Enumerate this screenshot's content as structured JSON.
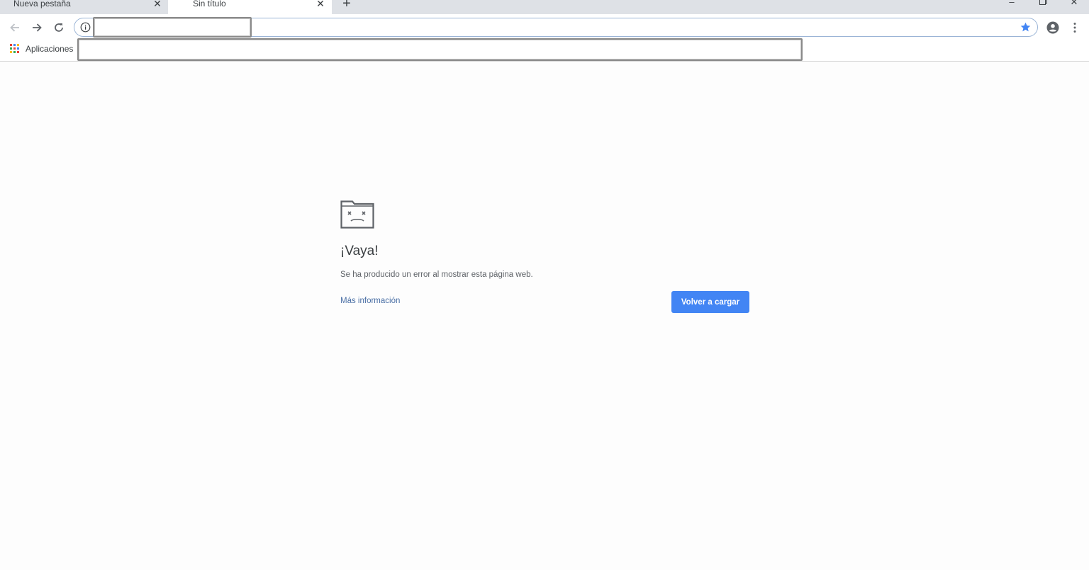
{
  "tabs": [
    {
      "title": "Nueva pestaña",
      "active": false
    },
    {
      "title": "Sin título",
      "active": true
    }
  ],
  "toolbar": {
    "back_icon": "arrow-left-icon",
    "forward_icon": "arrow-right-icon",
    "reload_icon": "reload-icon",
    "site_info_icon": "info-icon",
    "bookmark_icon": "star-icon",
    "profile_icon": "account-icon",
    "menu_icon": "kebab-menu-icon"
  },
  "bookmarks": {
    "apps_label": "Aplicaciones"
  },
  "error_page": {
    "heading": "¡Vaya!",
    "message": "Se ha producido un error al mostrar esta página web.",
    "learn_more": "Más información",
    "reload_button": "Volver a cargar"
  },
  "colors": {
    "tabstrip": "#dee1e6",
    "accent": "#4285f4",
    "link": "#4a6fa5",
    "text": "#3c4043"
  }
}
